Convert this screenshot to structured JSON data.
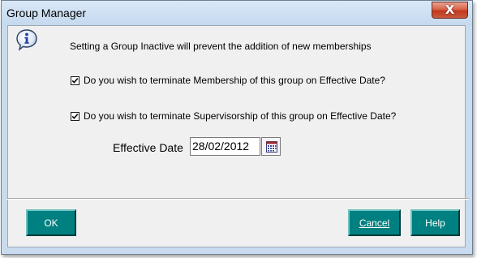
{
  "window": {
    "title": "Group Manager",
    "close_glyph": "X"
  },
  "message": {
    "icon": "info-icon",
    "text": "Setting a Group Inactive will prevent the addition of new memberships"
  },
  "options": [
    {
      "label": "Do you wish to terminate Membership of this group on Effective Date?",
      "checked": true
    },
    {
      "label": "Do you wish to terminate Supervisorship of this group on Effective Date?",
      "checked": true
    }
  ],
  "effective_date": {
    "label": "Effective Date",
    "value": "28/02/2012",
    "button_icon": "calendar-icon"
  },
  "buttons": {
    "ok": "OK",
    "cancel": "Cancel",
    "help": "Help"
  },
  "colors": {
    "button_teal": "#008080",
    "title_bar": "#c9dcef",
    "close_red": "#c0391f"
  }
}
